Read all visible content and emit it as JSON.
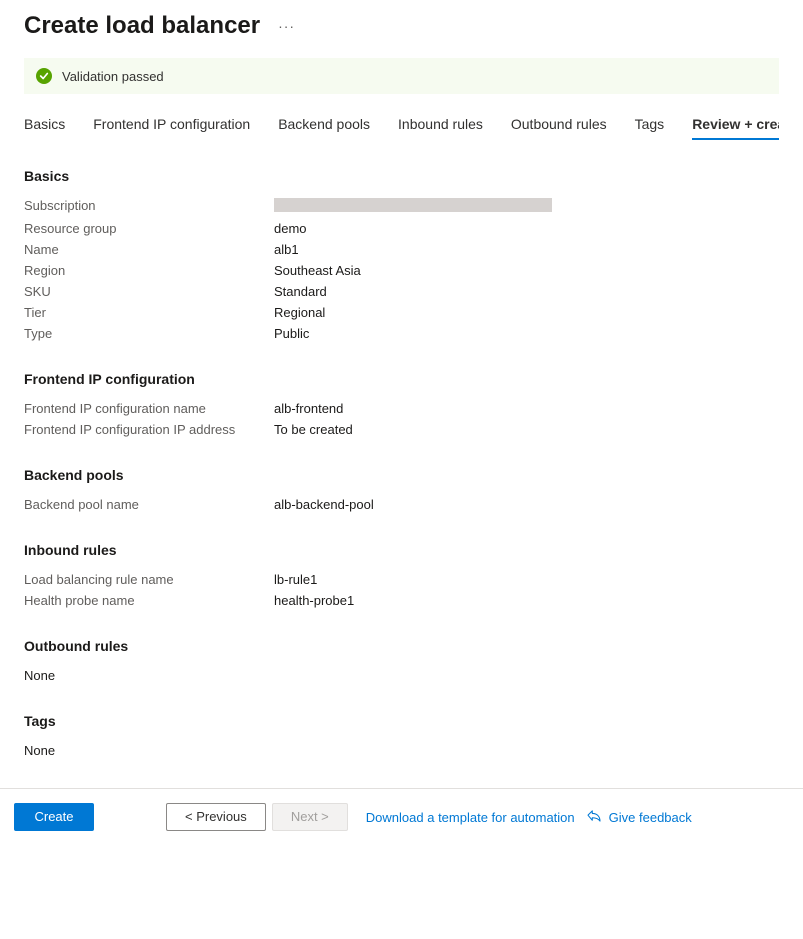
{
  "header": {
    "title": "Create load balancer"
  },
  "banner": {
    "text": "Validation passed"
  },
  "tabs": [
    {
      "label": "Basics",
      "active": false
    },
    {
      "label": "Frontend IP configuration",
      "active": false
    },
    {
      "label": "Backend pools",
      "active": false
    },
    {
      "label": "Inbound rules",
      "active": false
    },
    {
      "label": "Outbound rules",
      "active": false
    },
    {
      "label": "Tags",
      "active": false
    },
    {
      "label": "Review + create",
      "active": true
    }
  ],
  "sections": {
    "basics": {
      "title": "Basics",
      "rows": [
        {
          "key": "Subscription",
          "val": "",
          "redacted": true
        },
        {
          "key": "Resource group",
          "val": "demo"
        },
        {
          "key": "Name",
          "val": "alb1"
        },
        {
          "key": "Region",
          "val": "Southeast Asia"
        },
        {
          "key": "SKU",
          "val": "Standard"
        },
        {
          "key": "Tier",
          "val": "Regional"
        },
        {
          "key": "Type",
          "val": "Public"
        }
      ]
    },
    "frontend": {
      "title": "Frontend IP configuration",
      "rows": [
        {
          "key": "Frontend IP configuration name",
          "val": "alb-frontend"
        },
        {
          "key": "Frontend IP configuration IP address",
          "val": "To be created"
        }
      ]
    },
    "backend": {
      "title": "Backend pools",
      "rows": [
        {
          "key": "Backend pool name",
          "val": "alb-backend-pool"
        }
      ]
    },
    "inbound": {
      "title": "Inbound rules",
      "rows": [
        {
          "key": "Load balancing rule name",
          "val": "lb-rule1"
        },
        {
          "key": "Health probe name",
          "val": "health-probe1"
        }
      ]
    },
    "outbound": {
      "title": "Outbound rules",
      "none": "None"
    },
    "tags": {
      "title": "Tags",
      "none": "None"
    }
  },
  "footer": {
    "create": "Create",
    "previous": "< Previous",
    "next": "Next >",
    "download": "Download a template for automation",
    "feedback": "Give feedback"
  }
}
